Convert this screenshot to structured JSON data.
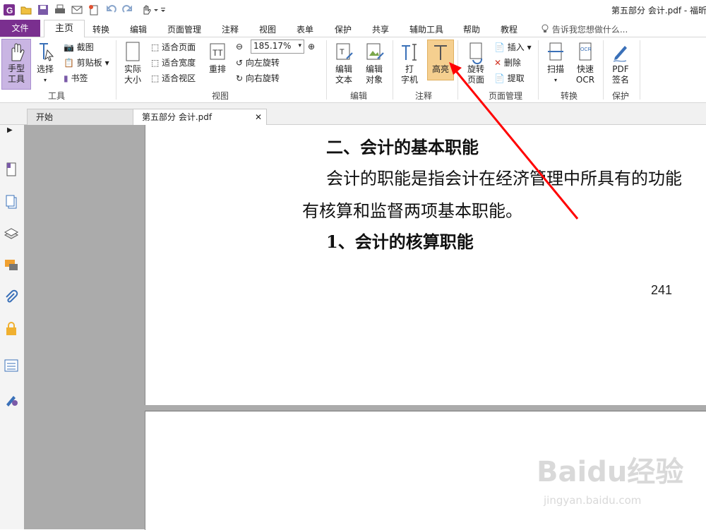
{
  "titlebar": {
    "document_title": "第五部分  会计.pdf - 福昕"
  },
  "menu": {
    "file": "文件",
    "tabs": [
      "主页",
      "转换",
      "编辑",
      "页面管理",
      "注释",
      "视图",
      "表单",
      "保护",
      "共享",
      "辅助工具",
      "帮助",
      "教程"
    ],
    "tell_me": "告诉我您想做什么..."
  },
  "ribbon": {
    "tools": {
      "hand": "手型\n工具",
      "select": "选择",
      "screenshot": "截图",
      "clipboard": "剪贴板",
      "bookmark": "书签",
      "group": "工具"
    },
    "view": {
      "actual_size": "实际\n大小",
      "fit_page": "适合页面",
      "fit_width": "适合宽度",
      "fit_visible": "适合视区",
      "reflow": "重排",
      "zoom": "185.17%",
      "rotate_left": "向左旋转",
      "rotate_right": "向右旋转",
      "group": "视图"
    },
    "edit": {
      "edit_text": "编辑\n文本",
      "edit_object": "编辑\n对象",
      "group": "编辑"
    },
    "comment": {
      "typewriter": "打\n字机",
      "highlight": "高亮",
      "group": "注释"
    },
    "page_mgmt": {
      "rotate_page": "旋转\n页面",
      "insert": "插入",
      "delete": "删除",
      "extract": "提取",
      "group": "页面管理"
    },
    "convert": {
      "scan": "扫描",
      "quick_ocr": "快速\nOCR",
      "group": "转换"
    },
    "protect": {
      "pdf_sign": "PDF\n签名",
      "group": "保护"
    }
  },
  "doc_tabs": [
    {
      "label": "开始"
    },
    {
      "label": "第五部分  会计.pdf"
    }
  ],
  "page": {
    "heading1": "二、会计的基本职能",
    "para_line1": "会计的职能是指会计在经济管理中所具有的功能",
    "para_line2": "有核算和监督两项基本职能。",
    "heading2": "1、会计的核算职能",
    "page_number": "241"
  },
  "watermark": {
    "brand": "Baidu经验",
    "url": "jingyan.baidu.com"
  },
  "colors": {
    "file_tab": "#7a2f8f",
    "hand_tool_bg": "#c9b5e3",
    "highlight_bg": "#f5cf8f",
    "annotation_arrow": "#ff0000"
  }
}
